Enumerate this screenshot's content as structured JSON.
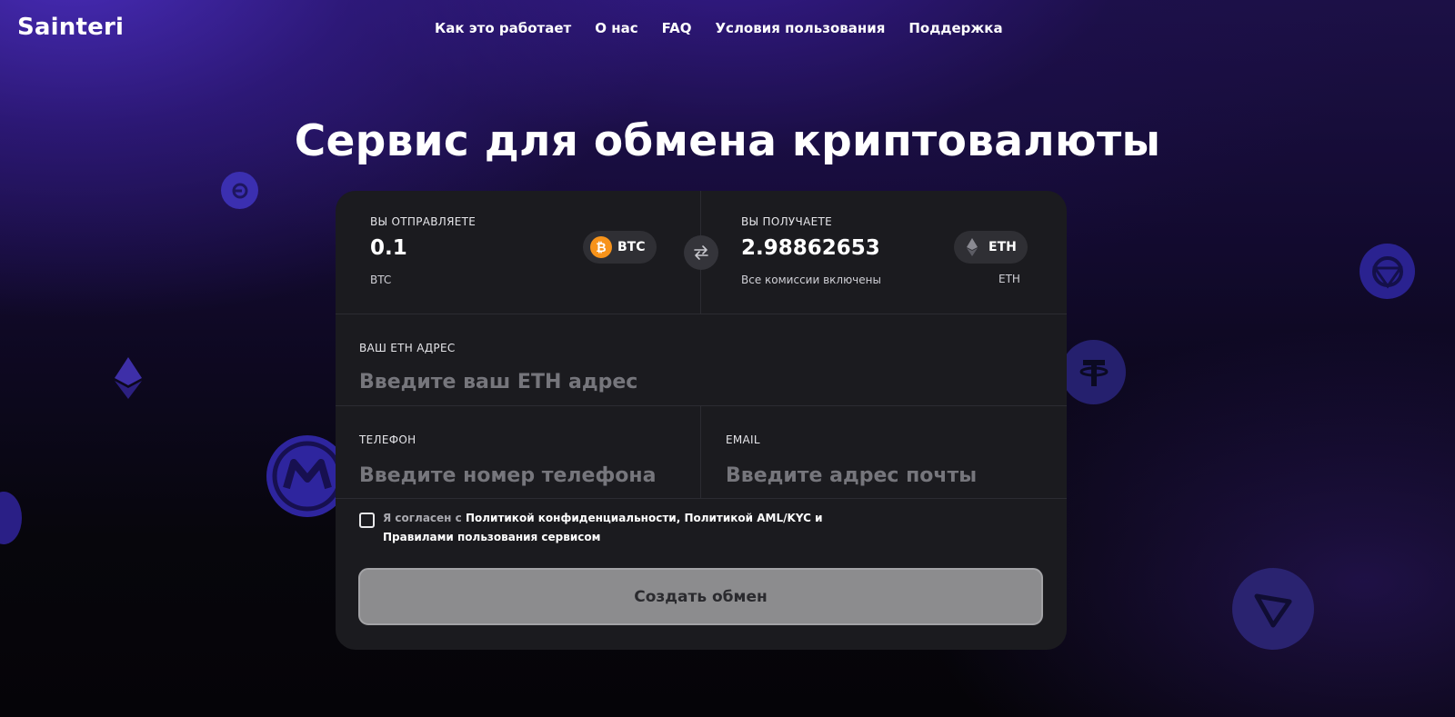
{
  "header": {
    "logo": "Sainteri",
    "nav": [
      {
        "label": "Как это работает"
      },
      {
        "label": "О нас"
      },
      {
        "label": "FAQ"
      },
      {
        "label": "Условия пользования"
      },
      {
        "label": "Поддержка"
      }
    ]
  },
  "hero": {
    "title": "Сервис для обмена криптовалюты"
  },
  "exchange": {
    "send": {
      "label": "ВЫ ОТПРАВЛЯЕТЕ",
      "amount": "0.1",
      "currency_sub": "BTC",
      "coin_button": "BTC",
      "coin_icon": "bitcoin-icon"
    },
    "receive": {
      "label": "ВЫ ПОЛУЧАЕТЕ",
      "amount": "2.98862653",
      "note": "Все комиссии включены",
      "currency_sub": "ETH",
      "coin_button": "ETH",
      "coin_icon": "ethereum-icon"
    },
    "swap_icon": "swap-arrows-icon"
  },
  "form": {
    "address_label": "ВАШ ETH АДРЕС",
    "address_placeholder": "Введите ваш ETH адрес",
    "phone_label": "ТЕЛЕФОН",
    "phone_placeholder": "Введите номер телефона",
    "email_label": "EMAIL",
    "email_placeholder": "Введите адрес почты"
  },
  "agreement": {
    "prefix": "Я согласен с ",
    "privacy_link": "Политикой конфиденциальности",
    "separator": ", ",
    "aml_link": "Политикой AML/KYC",
    "and": " и ",
    "rules_link": "Правилами пользования сервисом"
  },
  "submit_label": "Создать обмен",
  "colors": {
    "accent_purple": "#4a2dbe",
    "card_bg": "#1b1b1f",
    "button_bg": "#8c8c8e",
    "bitcoin_orange": "#f7931a"
  }
}
